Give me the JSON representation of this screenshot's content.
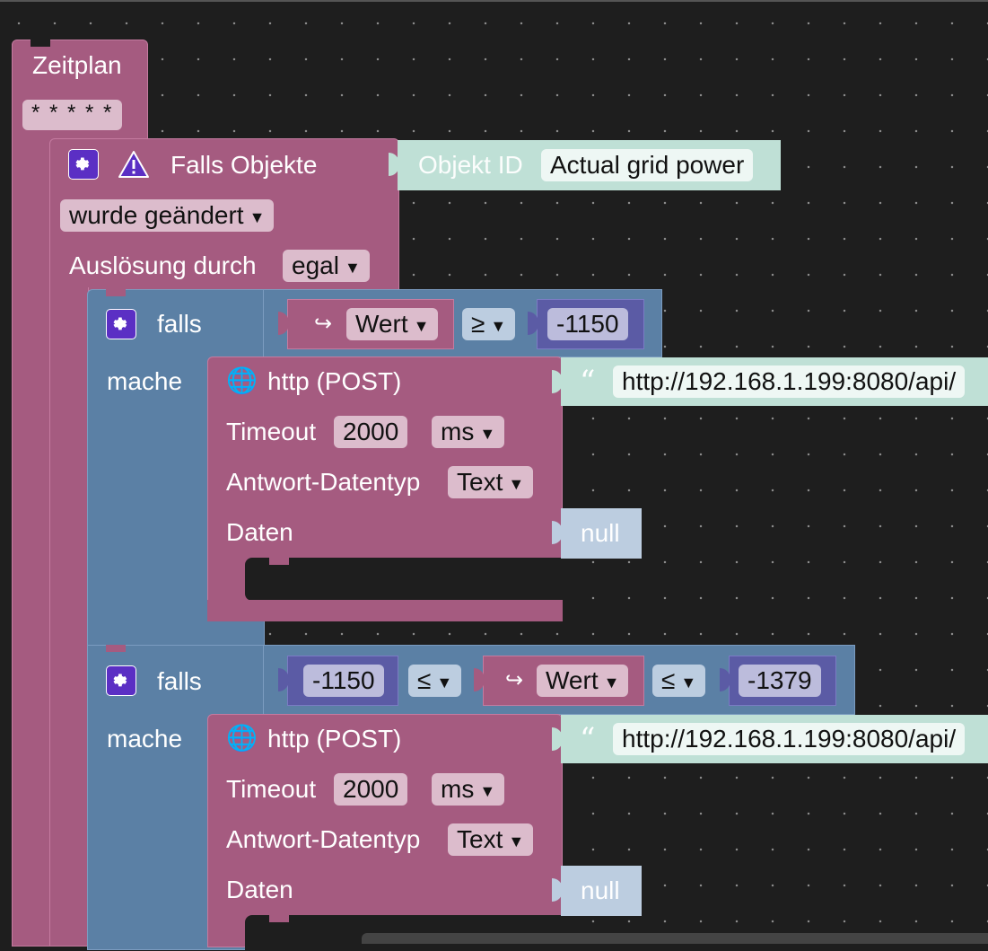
{
  "zeitplan": {
    "title": "Zeitplan",
    "cron": "* * * * *"
  },
  "trigger": {
    "title": "Falls Objekte",
    "object_label": "Objekt ID",
    "object_value": "Actual grid power",
    "changed": "wurde geändert",
    "triggered_by_label": "Auslösung durch",
    "triggered_by": "egal"
  },
  "if1": {
    "falls": "falls",
    "mache": "mache",
    "value_label": "Wert",
    "operator": "≥",
    "number": "-1150",
    "http": {
      "title": "http (POST)",
      "url": "http://192.168.1.199:8080/api/",
      "timeout_label": "Timeout",
      "timeout_value": "2000",
      "unit": "ms",
      "response_label": "Antwort-Datentyp",
      "response_type": "Text",
      "data_label": "Daten",
      "data_value": "null"
    }
  },
  "if2": {
    "falls": "falls",
    "mache": "mache",
    "number_left": "-1150",
    "op_left": "≤",
    "value_label": "Wert",
    "op_right": "≤",
    "number_right": "-1379",
    "http": {
      "title": "http (POST)",
      "url": "http://192.168.1.199:8080/api/",
      "timeout_label": "Timeout",
      "timeout_value": "2000",
      "unit": "ms",
      "response_label": "Antwort-Datentyp",
      "response_type": "Text",
      "data_label": "Daten",
      "data_value": "null"
    }
  },
  "icons": {
    "gear": "gear-icon",
    "warning": "warning-icon",
    "globe": "globe-icon",
    "quote": "quote-icon",
    "arrow": "dropdown-arrow-icon",
    "var": "variable-arrow-icon"
  },
  "colors": {
    "event": "#a55b80",
    "logic": "#5b80a5",
    "text": "#bfe0d6",
    "math": "#5b5ba5",
    "null": "#bccde0",
    "workspace": "#1e1e1e"
  }
}
